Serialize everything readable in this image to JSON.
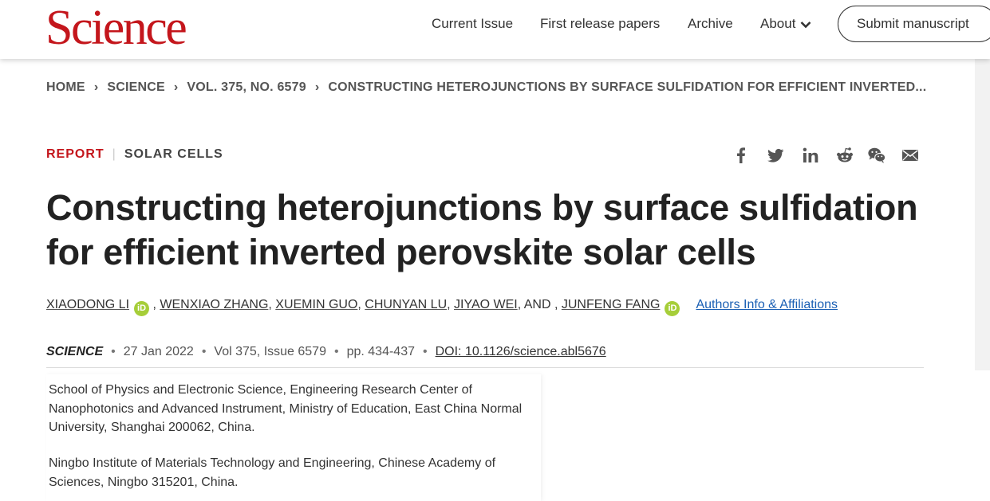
{
  "header": {
    "logo": "Science",
    "nav": [
      "Current Issue",
      "First release papers",
      "Archive",
      "About"
    ],
    "submit_label": "Submit manuscript"
  },
  "breadcrumb": [
    "HOME",
    "SCIENCE",
    "VOL. 375, NO. 6579",
    "CONSTRUCTING HETEROJUNCTIONS BY SURFACE SULFIDATION FOR EFFICIENT INVERTED..."
  ],
  "article": {
    "type": "REPORT",
    "category": "SOLAR CELLS",
    "title": "Constructing heterojunctions by surface sulfidation for efficient inverted perovskite solar cells",
    "authors": [
      "XIAODONG LI",
      "WENXIAO ZHANG",
      "XUEMIN GUO",
      "CHUNYAN LU",
      "JIYAO WEI",
      "JUNFENG FANG"
    ],
    "and_text": "AND",
    "orcid_label": "iD",
    "affiliations_link": "Authors Info & Affiliations",
    "journal": "SCIENCE",
    "date": "27 Jan 2022",
    "volume": "Vol 375, Issue 6579",
    "pages": "pp. 434-437",
    "doi": "DOI: 10.1126/science.abl5676"
  },
  "affiliations": [
    "School of Physics and Electronic Science, Engineering Research Center of Nanophotonics and Advanced Instrument, Ministry of Education, East China Normal University, Shanghai 200062, China.",
    "Ningbo Institute of Materials Technology and Engineering, Chinese Academy of Sciences, Ningbo 315201, China."
  ],
  "share_icons": [
    "facebook-icon",
    "twitter-icon",
    "linkedin-icon",
    "reddit-icon",
    "wechat-icon",
    "email-icon"
  ],
  "colors": {
    "brand_red": "#c4161c",
    "link_blue": "#1a5fb4",
    "orcid_green": "#a6ce39"
  }
}
